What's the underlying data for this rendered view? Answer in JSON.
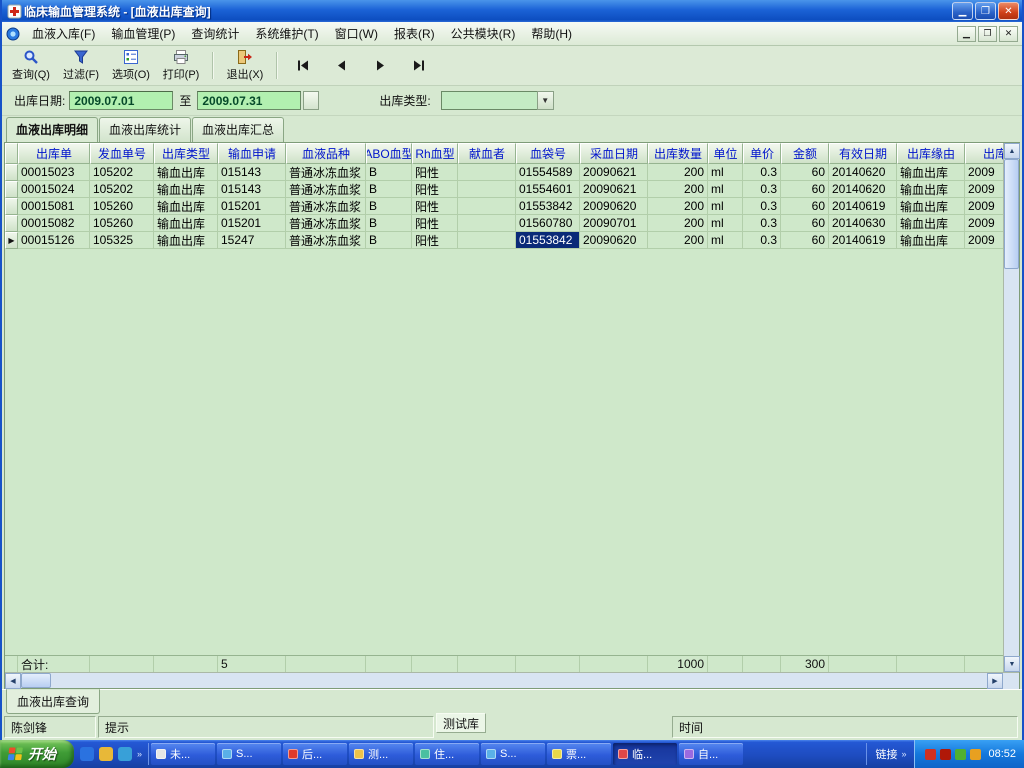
{
  "window": {
    "title": "临床输血管理系统 - [血液出库查询]"
  },
  "menubar": {
    "items": [
      "血液入库(F)",
      "输血管理(P)",
      "查询统计",
      "系统维护(T)",
      "窗口(W)",
      "报表(R)",
      "公共模块(R)",
      "帮助(H)"
    ]
  },
  "toolbar": {
    "query": "查询(Q)",
    "filter": "过滤(F)",
    "options": "选项(O)",
    "print": "打印(P)",
    "exit": "退出(X)"
  },
  "filterbar": {
    "date_label": "出库日期:",
    "date_from": "2009.07.01",
    "to": "至",
    "date_to": "2009.07.31",
    "type_label": "出库类型:",
    "type_value": ""
  },
  "tabs": [
    {
      "label": "血液出库明细",
      "active": true
    },
    {
      "label": "血液出库统计",
      "active": false
    },
    {
      "label": "血液出库汇总",
      "active": false
    }
  ],
  "grid": {
    "columns": [
      "出库单",
      "发血单号",
      "出库类型",
      "输血申请",
      "血液品种",
      "ABO血型",
      "Rh血型",
      "献血者",
      "血袋号",
      "采血日期",
      "出库数量",
      "单位",
      "单价",
      "金额",
      "有效日期",
      "出库缘由",
      "出库"
    ],
    "rows": [
      [
        "00015023",
        "105202",
        "输血出库",
        "015143",
        "普通冰冻血浆",
        "B",
        "阳性",
        "",
        "01554589",
        "20090621",
        "200",
        "ml",
        "0.3",
        "60",
        "20140620",
        "输血出库",
        "2009"
      ],
      [
        "00015024",
        "105202",
        "输血出库",
        "015143",
        "普通冰冻血浆",
        "B",
        "阳性",
        "",
        "01554601",
        "20090621",
        "200",
        "ml",
        "0.3",
        "60",
        "20140620",
        "输血出库",
        "2009"
      ],
      [
        "00015081",
        "105260",
        "输血出库",
        "015201",
        "普通冰冻血浆",
        "B",
        "阳性",
        "",
        "01553842",
        "20090620",
        "200",
        "ml",
        "0.3",
        "60",
        "20140619",
        "输血出库",
        "2009"
      ],
      [
        "00015082",
        "105260",
        "输血出库",
        "015201",
        "普通冰冻血浆",
        "B",
        "阳性",
        "",
        "01560780",
        "20090701",
        "200",
        "ml",
        "0.3",
        "60",
        "20140630",
        "输血出库",
        "2009"
      ],
      [
        "00015126",
        "105325",
        "输血出库",
        "15247",
        "普通冰冻血浆",
        "B",
        "阳性",
        "",
        "01553842",
        "20090620",
        "200",
        "ml",
        "0.3",
        "60",
        "20140619",
        "输血出库",
        "2009"
      ]
    ],
    "selected": {
      "row": 4,
      "col": 8
    },
    "summary": [
      "合计:",
      "",
      "",
      "5",
      "",
      "",
      "",
      "",
      "",
      "",
      "1000",
      "",
      "",
      "300",
      "",
      "",
      ""
    ]
  },
  "bottom_tab": "血液出库查询",
  "statusbar": {
    "user": "陈剑锋",
    "hint": "提示",
    "db": "测试库",
    "time": "时间"
  },
  "taskbar": {
    "start": "开始",
    "quick_launch_icons": [
      "#2a72e0",
      "#e8b838",
      "#38a0d8"
    ],
    "tasks": [
      {
        "label": "未...",
        "color": "#e6e6e6",
        "active": false
      },
      {
        "label": "S...",
        "color": "#5ab0e8",
        "active": false
      },
      {
        "label": "后...",
        "color": "#e03a2a",
        "active": false
      },
      {
        "label": "测...",
        "color": "#eec24a",
        "active": false
      },
      {
        "label": "住...",
        "color": "#4ac0a0",
        "active": false
      },
      {
        "label": "S...",
        "color": "#5ab0e8",
        "active": false
      },
      {
        "label": "票...",
        "color": "#e8d84a",
        "active": false
      },
      {
        "label": "临...",
        "color": "#e04848",
        "active": true
      },
      {
        "label": "自...",
        "color": "#9a6ae0",
        "active": false
      }
    ],
    "links": "链接",
    "tray_icons": [
      "#d03020",
      "#b01808",
      "#50b030",
      "#e8a020"
    ],
    "clock": "08:52"
  }
}
